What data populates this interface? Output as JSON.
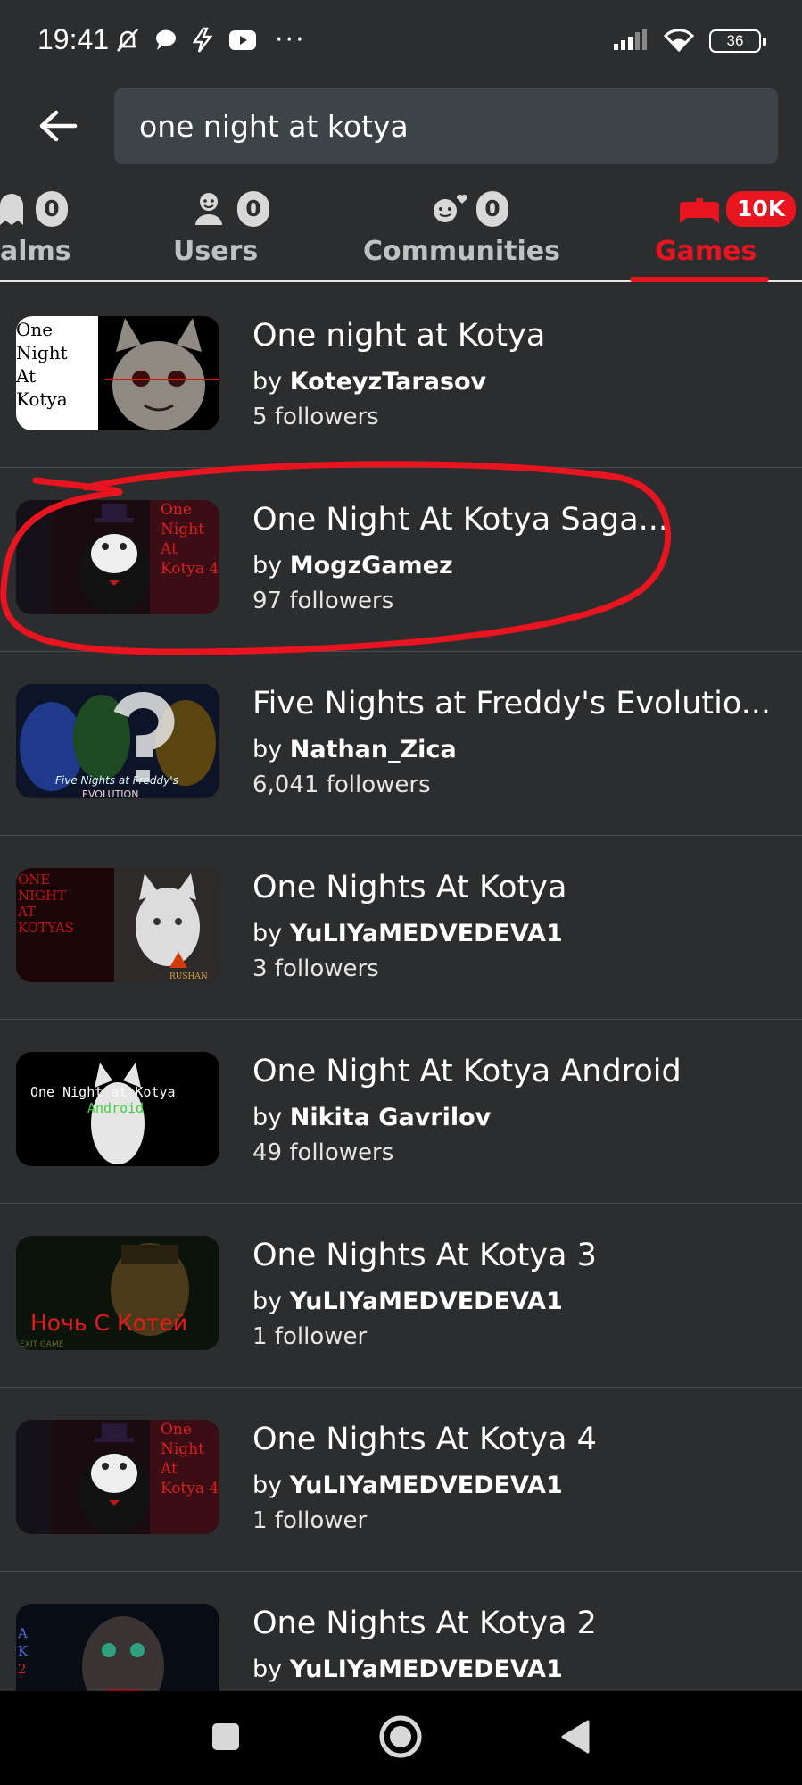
{
  "status_bar": {
    "time": "19:41",
    "battery": "36",
    "left_icons": [
      "bell-off-icon",
      "chat-bubble-icon",
      "lightning-icon",
      "youtube-icon"
    ],
    "overflow": "···",
    "right_icons": [
      "signal-icon",
      "wifi-icon",
      "battery-icon"
    ]
  },
  "search": {
    "value": "one night at kotya",
    "back_icon": "arrow-left-icon"
  },
  "tabs": [
    {
      "label": "alms",
      "count": "0",
      "icon": "ghost-icon",
      "active": false
    },
    {
      "label": "Users",
      "count": "0",
      "icon": "user-icon",
      "active": false
    },
    {
      "label": "Communities",
      "count": "0",
      "icon": "community-icon",
      "active": false
    },
    {
      "label": "Games",
      "count": "10K",
      "icon": "gamepad-icon",
      "active": true
    }
  ],
  "results": [
    {
      "title": "One night at Kotya",
      "by": "by",
      "author": "KoteyzTarasov",
      "followers": "5 followers",
      "thumb_text": [
        "One",
        "Night",
        "At",
        "Kotya"
      ]
    },
    {
      "title": "One Night At Kotya Saga...",
      "by": "by",
      "author": "MogzGamez",
      "followers": "97 followers",
      "thumb_text": [
        "One",
        "Night",
        "At",
        "Kotya 4"
      ]
    },
    {
      "title": "Five Nights at Freddy's Evolutio...",
      "by": "by",
      "author": "Nathan_Zica",
      "followers": "6,041 followers",
      "thumb_text": [
        "Five Nights at Freddy's",
        "EVOLUTION"
      ]
    },
    {
      "title": "One Nights At Kotya",
      "by": "by",
      "author": "YuLIYaMEDVEDEVA1",
      "followers": "3 followers",
      "thumb_text": [
        "ONE",
        "NIGHT",
        "AT",
        "KOTYAS",
        "RUSHAN"
      ]
    },
    {
      "title": "One Night At Kotya Android",
      "by": "by",
      "author": "Nikita Gavrilov",
      "followers": "49 followers",
      "thumb_text": [
        "One Night at Kotya",
        "Android"
      ]
    },
    {
      "title": "One Nights At Kotya 3",
      "by": "by",
      "author": "YuLIYaMEDVEDEVA1",
      "followers": "1 follower",
      "thumb_text": [
        "Ночь С Котей",
        "EXIT GAME"
      ]
    },
    {
      "title": "One Nights At Kotya 4",
      "by": "by",
      "author": "YuLIYaMEDVEDEVA1",
      "followers": "1 follower",
      "thumb_text": [
        "One",
        "Night",
        "At",
        "Kotya 4"
      ]
    },
    {
      "title": "One Nights At Kotya 2",
      "by": "by",
      "author": "YuLIYaMEDVEDEVA1",
      "followers": "",
      "thumb_text": [
        "A",
        "K",
        "2"
      ]
    }
  ],
  "highlight": {
    "color": "#e8141f",
    "target": "One Night At Kotya Saga..."
  },
  "colors": {
    "background": "#2b2d2e",
    "accent": "#e8141f",
    "search_bg": "#3d4447",
    "badge": "#d8d8d8"
  },
  "nav_bar": {
    "buttons": [
      "recents-square-icon",
      "home-circle-icon",
      "back-triangle-icon"
    ]
  }
}
